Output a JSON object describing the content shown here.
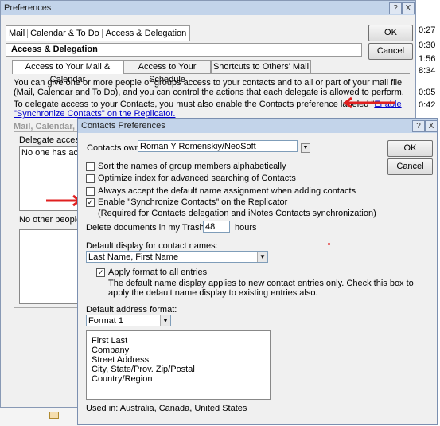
{
  "bg": {
    "times": [
      "0:27",
      "0:30",
      "1:56",
      "8:34",
      "0:05",
      "0:42"
    ]
  },
  "prefs": {
    "title": "Preferences",
    "help_btn": "?",
    "close_btn": "X",
    "nav": {
      "mail": "Mail",
      "calendar": "Calendar & To Do",
      "access": "Access & Delegation"
    },
    "ok": "OK",
    "cancel": "Cancel",
    "section_title": "Access & Delegation",
    "tabs": [
      "Access to Your Mail & Calendar",
      "Access to Your Schedule",
      "Shortcuts to Others' Mail"
    ],
    "desc_line1": "You can give one or more people or groups access to your contacts and to all or part of your mail file",
    "desc_line2": "(Mail, Calendar and To Do), and you can control the actions that each delegate is allowed to perform.",
    "deleg_line1": "To delegate access to your Contacts, you must also enable the Contacts preference labeled \"",
    "deleg_link1": "Enable",
    "deleg_link2": "\"Synchronize Contacts\" on the Replicator.",
    "deleg_end": "\"",
    "mail_cal_heading": "Mail, Calendar, T",
    "delegate_access": "Delegate access t",
    "no_one": "No one has acc",
    "no_other": "No other people o"
  },
  "cp": {
    "title": "Contacts Preferences",
    "help_btn": "?",
    "close_btn": "X",
    "owner_label": "Contacts owner:",
    "owner_value": "Roman Y Romenskiy/NeoSoft",
    "ok": "OK",
    "cancel": "Cancel",
    "opt_sort": "Sort the names of group members alphabetically",
    "opt_optimize": "Optimize index for advanced searching of Contacts",
    "opt_accept": "Always accept the default name assignment when adding contacts",
    "opt_sync": "Enable \"Synchronize Contacts\" on the Replicator",
    "opt_sync_note": "(Required for Contacts delegation and iNotes Contacts synchronization)",
    "delete_label": "Delete documents in my Trash after",
    "delete_value": "48",
    "delete_unit": "hours",
    "display_label": "Default display for contact names:",
    "display_value": "Last Name, First Name",
    "apply_label": "Apply format to all entries",
    "apply_note1": "The default name display applies to new contact entries only.  Check this box to",
    "apply_note2": "apply the default name display to existing entries also.",
    "addr_label": "Default address format:",
    "addr_value": "Format 1",
    "addr_lines": [
      "First Last",
      "Company",
      "Street Address",
      "City, State/Prov. Zip/Postal",
      "Country/Region"
    ],
    "used_in": "Used in: Australia, Canada, United States",
    "checked": {
      "sort": false,
      "optimize": false,
      "accept": false,
      "sync": true,
      "apply": true
    }
  },
  "colors": {
    "arrow": "#e02020",
    "link": "#0000cc",
    "title_bg": "#c3d4ea"
  }
}
